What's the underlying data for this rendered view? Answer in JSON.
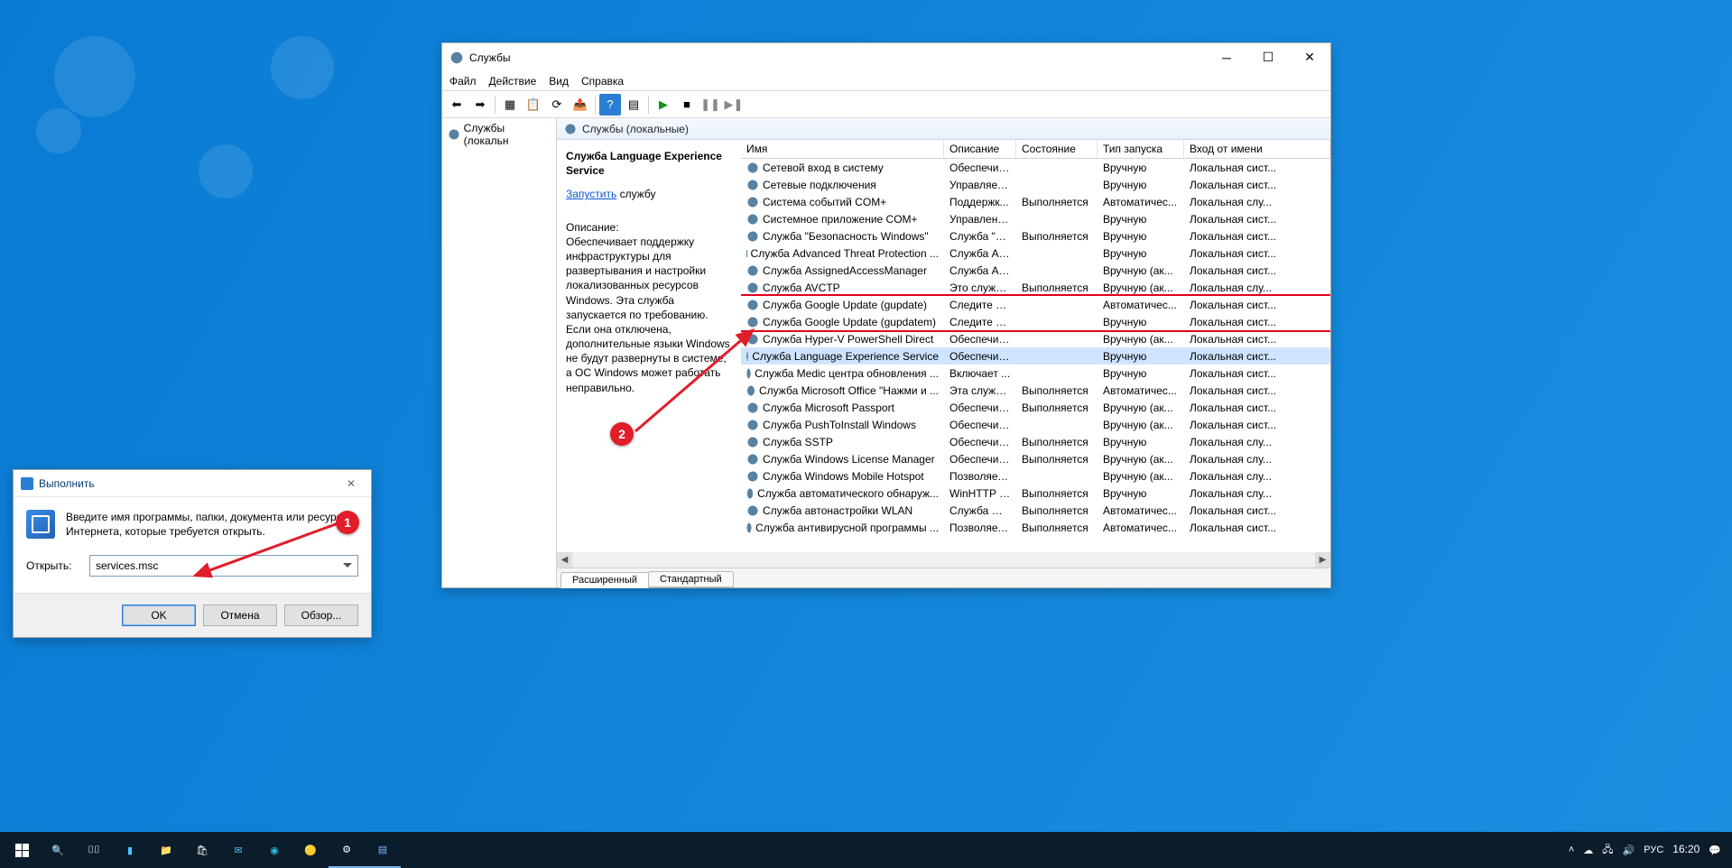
{
  "services_window": {
    "title": "Службы",
    "menu": [
      "Файл",
      "Действие",
      "Вид",
      "Справка"
    ],
    "tree_node": "Службы (локальн",
    "pane_header": "Службы (локальные)",
    "detail": {
      "name_heading": "Служба Language Experience Service",
      "action_link": "Запустить",
      "action_suffix": " службу",
      "desc_heading": "Описание:",
      "description": "Обеспечивает поддержку инфраструктуры для развертывания и настройки локализованных ресурсов Windows. Эта служба запускается по требованию. Если она отключена, дополнительные языки Windows не будут развернуты в системе, а ОС Windows может работать неправильно."
    },
    "columns": [
      "Имя",
      "Описание",
      "Состояние",
      "Тип запуска",
      "Вход от имени"
    ],
    "services": [
      {
        "name": "Сетевой вход в систему",
        "desc": "Обеспечив...",
        "state": "",
        "start": "Вручную",
        "logon": "Локальная сист..."
      },
      {
        "name": "Сетевые подключения",
        "desc": "Управляет ...",
        "state": "",
        "start": "Вручную",
        "logon": "Локальная сист..."
      },
      {
        "name": "Система событий COM+",
        "desc": "Поддержк...",
        "state": "Выполняется",
        "start": "Автоматичес...",
        "logon": "Локальная слу..."
      },
      {
        "name": "Системное приложение COM+",
        "desc": "Управлени...",
        "state": "",
        "start": "Вручную",
        "logon": "Локальная сист..."
      },
      {
        "name": "Служба \"Безопасность Windows\"",
        "desc": "Служба \"Б...",
        "state": "Выполняется",
        "start": "Вручную",
        "logon": "Локальная сист..."
      },
      {
        "name": "Служба Advanced Threat Protection ...",
        "desc": "Служба Ad...",
        "state": "",
        "start": "Вручную",
        "logon": "Локальная сист..."
      },
      {
        "name": "Служба AssignedAccessManager",
        "desc": "Служба As...",
        "state": "",
        "start": "Вручную (ак...",
        "logon": "Локальная сист..."
      },
      {
        "name": "Служба AVCTP",
        "desc": "Это служб...",
        "state": "Выполняется",
        "start": "Вручную (ак...",
        "logon": "Локальная слу..."
      },
      {
        "name": "Служба Google Update (gupdate)",
        "desc": "Следите за ...",
        "state": "",
        "start": "Автоматичес...",
        "logon": "Локальная сист...",
        "hl": true
      },
      {
        "name": "Служба Google Update (gupdatem)",
        "desc": "Следите за ...",
        "state": "",
        "start": "Вручную",
        "logon": "Локальная сист...",
        "hl": true
      },
      {
        "name": "Служба Hyper-V PowerShell Direct",
        "desc": "Обеспечив...",
        "state": "",
        "start": "Вручную (ак...",
        "logon": "Локальная сист..."
      },
      {
        "name": "Служба Language Experience Service",
        "desc": "Обеспечив...",
        "state": "",
        "start": "Вручную",
        "logon": "Локальная сист...",
        "selected": true
      },
      {
        "name": "Служба Medic центра обновления ...",
        "desc": "Включает ...",
        "state": "",
        "start": "Вручную",
        "logon": "Локальная сист..."
      },
      {
        "name": "Служба Microsoft Office \"Нажми и ...",
        "desc": "Эта служба...",
        "state": "Выполняется",
        "start": "Автоматичес...",
        "logon": "Локальная сист..."
      },
      {
        "name": "Служба Microsoft Passport",
        "desc": "Обеспечив...",
        "state": "Выполняется",
        "start": "Вручную (ак...",
        "logon": "Локальная сист..."
      },
      {
        "name": "Служба PushToInstall Windows",
        "desc": "Обеспечив...",
        "state": "",
        "start": "Вручную (ак...",
        "logon": "Локальная сист..."
      },
      {
        "name": "Служба SSTP",
        "desc": "Обеспечив...",
        "state": "Выполняется",
        "start": "Вручную",
        "logon": "Локальная слу..."
      },
      {
        "name": "Служба Windows License Manager",
        "desc": "Обеспечив...",
        "state": "Выполняется",
        "start": "Вручную (ак...",
        "logon": "Локальная слу..."
      },
      {
        "name": "Служба Windows Mobile Hotspot",
        "desc": "Позволяет ...",
        "state": "",
        "start": "Вручную (ак...",
        "logon": "Локальная слу..."
      },
      {
        "name": "Служба автоматического обнаруж...",
        "desc": "WinHTTP р...",
        "state": "Выполняется",
        "start": "Вручную",
        "logon": "Локальная слу..."
      },
      {
        "name": "Служба автонастройки WLAN",
        "desc": "Служба WL...",
        "state": "Выполняется",
        "start": "Автоматичес...",
        "logon": "Локальная сист..."
      },
      {
        "name": "Служба антивирусной программы ...",
        "desc": "Позволяет ...",
        "state": "Выполняется",
        "start": "Автоматичес...",
        "logon": "Локальная сист..."
      }
    ],
    "tabs": {
      "extended": "Расширенный",
      "standard": "Стандартный"
    }
  },
  "run_dialog": {
    "title": "Выполнить",
    "instruction": "Введите имя программы, папки, документа или ресурса Интернета, которые требуется открыть.",
    "open_label": "Открыть:",
    "open_value": "services.msc",
    "buttons": {
      "ok": "OK",
      "cancel": "Отмена",
      "browse": "Обзор..."
    }
  },
  "annotations": {
    "badge1": "1",
    "badge2": "2"
  },
  "taskbar": {
    "tray": {
      "lang": "РУС",
      "time": "16:20"
    }
  }
}
